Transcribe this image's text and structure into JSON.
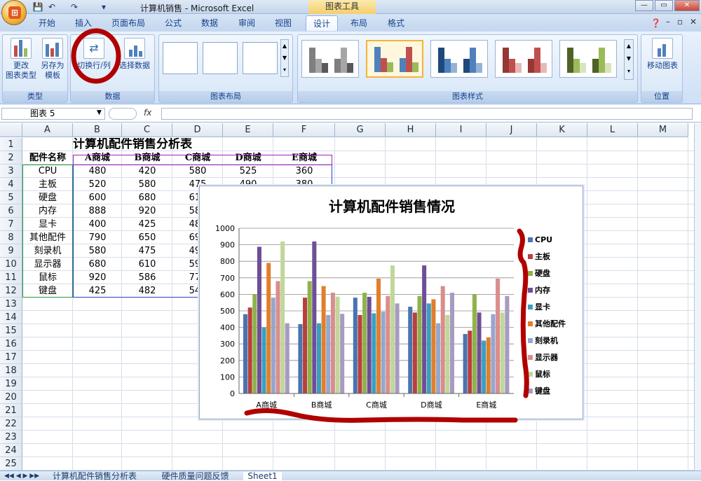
{
  "window": {
    "title": "计算机销售 - Microsoft Excel",
    "context_tab_group": "图表工具"
  },
  "tabs": [
    "开始",
    "插入",
    "页面布局",
    "公式",
    "数据",
    "审阅",
    "视图",
    "设计",
    "布局",
    "格式"
  ],
  "ribbon": {
    "groups": [
      {
        "label": "类型",
        "buttons": [
          "更改\n图表类型",
          "另存为\n模板"
        ]
      },
      {
        "label": "数据",
        "buttons": [
          "切换行/列",
          "选择数据"
        ]
      },
      {
        "label": "图表布局"
      },
      {
        "label": "图表样式"
      },
      {
        "label": "位置",
        "buttons": [
          "移动图表"
        ]
      }
    ],
    "change_type_l1": "更改",
    "change_type_l2": "图表类型",
    "save_tpl_l1": "另存为",
    "save_tpl_l2": "模板",
    "switch": "切换行/列",
    "select": "选择数据",
    "move": "移动图表",
    "label_type": "类型",
    "label_data": "数据",
    "label_layout": "图表布局",
    "label_style": "图表样式",
    "label_pos": "位置"
  },
  "formula_bar": {
    "name_box": "图表 5",
    "fx": "fx"
  },
  "columns": [
    "A",
    "B",
    "C",
    "D",
    "E",
    "F",
    "G",
    "H",
    "I",
    "J",
    "K",
    "L",
    "M"
  ],
  "rows": [
    "1",
    "2",
    "3",
    "4",
    "5",
    "6",
    "7",
    "8",
    "9",
    "10",
    "11",
    "12",
    "13",
    "14",
    "15",
    "16",
    "17",
    "18",
    "19",
    "20",
    "21",
    "22",
    "23",
    "24",
    "25"
  ],
  "sheet": {
    "title": "计算机配件销售分析表",
    "headers": [
      "配件名称",
      "A商城",
      "B商城",
      "C商城",
      "D商城",
      "E商城"
    ],
    "data": [
      [
        "CPU",
        "480",
        "420",
        "580",
        "525",
        "360"
      ],
      [
        "主板",
        "520",
        "580",
        "475",
        "490",
        "380"
      ],
      [
        "硬盘",
        "600",
        "680",
        "610",
        "",
        ""
      ],
      [
        "内存",
        "888",
        "920",
        "585",
        "",
        ""
      ],
      [
        "显卡",
        "400",
        "425",
        "485",
        "",
        ""
      ],
      [
        "其他配件",
        "790",
        "650",
        "695",
        "",
        ""
      ],
      [
        "刻录机",
        "580",
        "475",
        "495",
        "",
        ""
      ],
      [
        "显示器",
        "680",
        "610",
        "590",
        "",
        ""
      ],
      [
        "鼠标",
        "920",
        "586",
        "775",
        "",
        ""
      ],
      [
        "键盘",
        "425",
        "482",
        "545",
        "",
        ""
      ]
    ]
  },
  "chart_data": {
    "type": "bar",
    "title": "计算机配件销售情况",
    "categories": [
      "A商城",
      "B商城",
      "C商城",
      "D商城",
      "E商城"
    ],
    "ylim": [
      0,
      1000
    ],
    "yticks": [
      0,
      100,
      200,
      300,
      400,
      500,
      600,
      700,
      800,
      900,
      1000
    ],
    "grid": true,
    "legend": "right",
    "series": [
      {
        "name": "CPU",
        "color": "#4a73b0",
        "values": [
          480,
          420,
          580,
          525,
          360
        ]
      },
      {
        "name": "主板",
        "color": "#b8403c",
        "values": [
          520,
          580,
          475,
          490,
          380
        ]
      },
      {
        "name": "硬盘",
        "color": "#8fb24a",
        "values": [
          600,
          680,
          610,
          590,
          600
        ]
      },
      {
        "name": "内存",
        "color": "#6e4e96",
        "values": [
          888,
          920,
          585,
          775,
          490
        ]
      },
      {
        "name": "显卡",
        "color": "#3a9fbe",
        "values": [
          400,
          425,
          485,
          545,
          320
        ]
      },
      {
        "name": "其他配件",
        "color": "#e07f2c",
        "values": [
          790,
          650,
          695,
          570,
          340
        ]
      },
      {
        "name": "刻录机",
        "color": "#95a7cf",
        "values": [
          580,
          475,
          495,
          425,
          480
        ]
      },
      {
        "name": "显示器",
        "color": "#d98e8c",
        "values": [
          680,
          610,
          590,
          650,
          695
        ]
      },
      {
        "name": "鼠标",
        "color": "#c1d79a",
        "values": [
          920,
          586,
          775,
          475,
          490
        ]
      },
      {
        "name": "键盘",
        "color": "#a79bc1",
        "values": [
          425,
          482,
          545,
          610,
          590
        ]
      }
    ]
  },
  "sheet_tabs": [
    "计算机配件销售分析表",
    "硬件质量问题反馈",
    "Sheet1"
  ]
}
